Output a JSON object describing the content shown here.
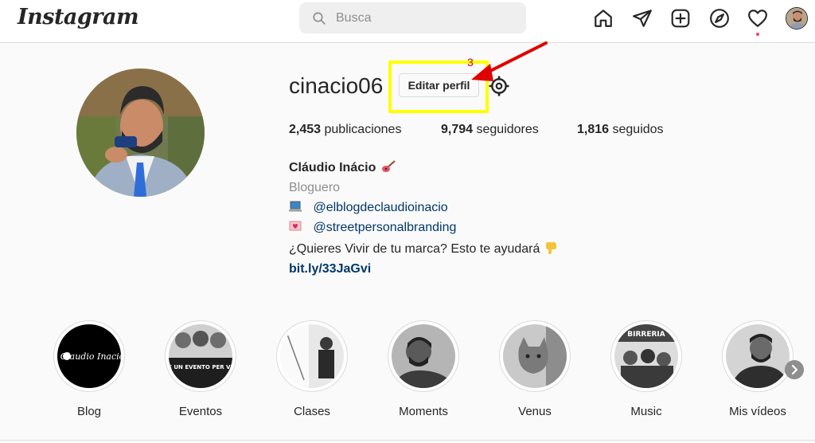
{
  "brand": {
    "logo_text": "Instagram"
  },
  "search": {
    "placeholder": "Busca"
  },
  "nav": {
    "icons": [
      "home-icon",
      "direct-message-icon",
      "new-post-icon",
      "explore-icon",
      "activity-heart-icon",
      "profile-avatar"
    ]
  },
  "profile": {
    "username": "cinacio06",
    "edit_label": "Editar perfil",
    "annotation_number": "3",
    "posts_count": "2,453",
    "posts_label": "publicaciones",
    "followers_count": "9,794",
    "followers_label": "seguidores",
    "following_count": "1,816",
    "following_label": "seguidos",
    "full_name": "Cláudio Inácio",
    "category": "Bloguero",
    "bio_link1": "@elblogdeclaudioinacio",
    "bio_link2": "@streetpersonalbranding",
    "bio_text": "¿Quieres Vivir de tu marca? Esto te ayudará",
    "website": "bit.ly/33JaGvi"
  },
  "highlights": [
    {
      "label": "Blog",
      "cover_text": "Claudio Inacio"
    },
    {
      "label": "Eventos",
      "cover_text": "NON È UN EVENTO PER VECCHI"
    },
    {
      "label": "Clases"
    },
    {
      "label": "Moments"
    },
    {
      "label": "Venus"
    },
    {
      "label": "Music",
      "cover_text": "BIRRERIA"
    },
    {
      "label": "Mis vídeos"
    }
  ],
  "colors": {
    "highlight_box": "#ffff00",
    "annotation_arrow": "#e00000",
    "link": "#00376b",
    "notification_dot": "#ed4956"
  }
}
